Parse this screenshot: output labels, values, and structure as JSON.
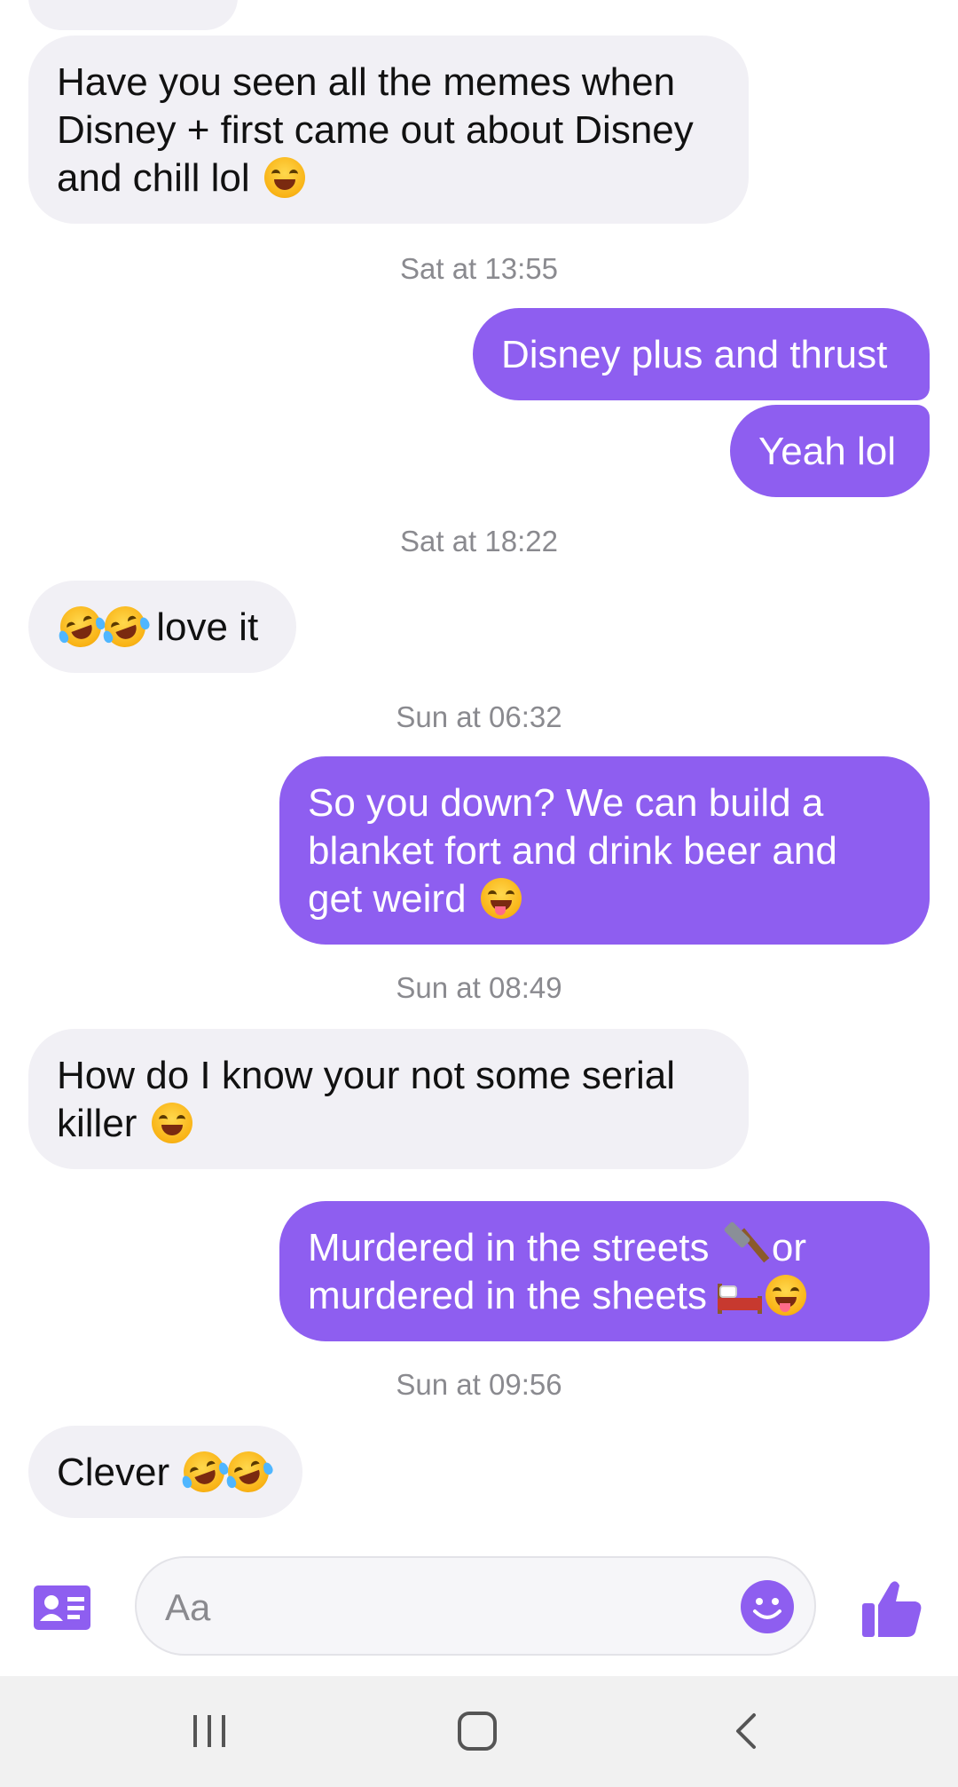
{
  "conversation": {
    "messages": [
      {
        "text": "Have you seen all the memes when Disney + first came out about Disney and chill lol",
        "emoji": "grinning-squinting-face"
      },
      {
        "timestamp": "Sat at 13:55"
      },
      {
        "text": "Disney plus and thrust"
      },
      {
        "text": "Yeah lol"
      },
      {
        "timestamp": "Sat at 18:22"
      },
      {
        "text": "love it",
        "emoji": "rolling-on-floor-laughing x2"
      },
      {
        "timestamp": "Sun at 06:32"
      },
      {
        "text": "So you down? We can build a blanket fort and drink beer and get weird",
        "emoji": "winking-face-with-tongue"
      },
      {
        "timestamp": "Sun at 08:49"
      },
      {
        "text": "How do I know your not some serial killer",
        "emoji": "grinning-squinting-face"
      },
      {
        "text_line1": "Murdered in the streets",
        "text_line1_end": "or",
        "text_line2": "murdered in the sheets",
        "emoji": "hammer, bed, winking-face-with-tongue"
      },
      {
        "timestamp": "Sun at 09:56"
      },
      {
        "text": "Clever",
        "emoji": "rolling-on-floor-laughing x2"
      }
    ]
  },
  "composer": {
    "placeholder": "Aa",
    "icons": [
      "contact-card-icon",
      "emoji-icon",
      "thumbs-up-icon"
    ]
  },
  "navbar": {
    "icons": [
      "recents-icon",
      "home-icon",
      "back-icon"
    ]
  },
  "colors": {
    "accent": "#8e5ef0",
    "incoming_bubble": "#f1f0f5",
    "timestamp": "#8a8a8f"
  }
}
